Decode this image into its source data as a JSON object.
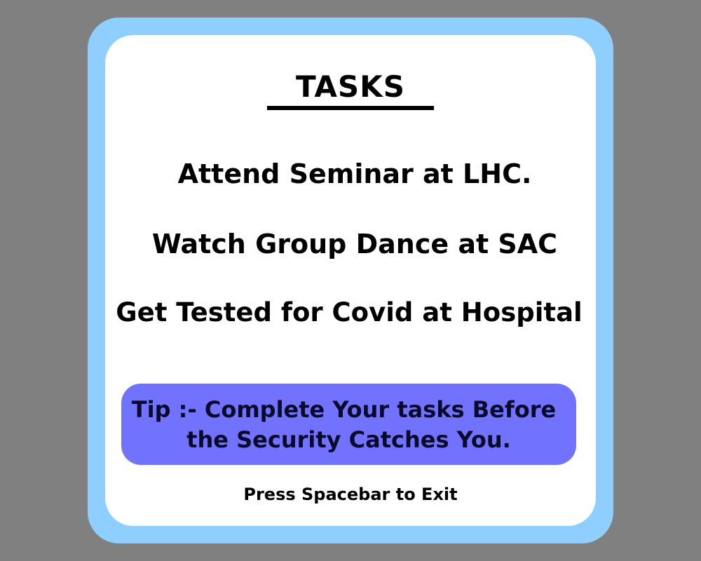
{
  "panel": {
    "title": "TASKS",
    "tasks": [
      "Attend Seminar at LHC.",
      "Watch Group Dance at SAC",
      "Get Tested for Covid at Hospital"
    ],
    "tip": {
      "line1": "Tip :- Complete Your tasks Before",
      "line2": "the Security Catches You."
    },
    "exit_hint": "Press Spacebar to Exit"
  },
  "colors": {
    "background": "#808080",
    "frame": "#8ecfff",
    "panel": "#ffffff",
    "tip_box": "#7173ff",
    "tip_text": "#0a0a2a"
  }
}
